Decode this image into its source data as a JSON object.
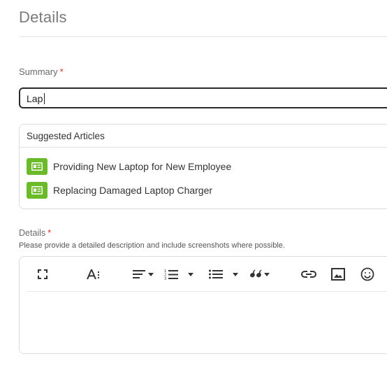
{
  "section": {
    "title": "Details"
  },
  "summary": {
    "label": "Summary",
    "required_mark": "*",
    "value": "Lap"
  },
  "suggested": {
    "header": "Suggested Articles",
    "articles": [
      {
        "title": "Providing New Laptop for New Employee",
        "icon": "article-icon"
      },
      {
        "title": "Replacing Damaged Laptop Charger",
        "icon": "article-icon"
      }
    ],
    "icon_color": "#6aba2a"
  },
  "details": {
    "label": "Details",
    "required_mark": "*",
    "helper": "Please provide a detailed description and include screenshots where possible.",
    "toolbar": [
      "fullscreen-icon",
      "text-size-icon",
      "align-icon",
      "numbered-list-icon",
      "bullet-list-icon",
      "quote-icon",
      "link-icon",
      "image-icon",
      "emoji-icon"
    ]
  },
  "colors": {
    "required": "#d93025",
    "input_border": "#2b2b2b"
  }
}
